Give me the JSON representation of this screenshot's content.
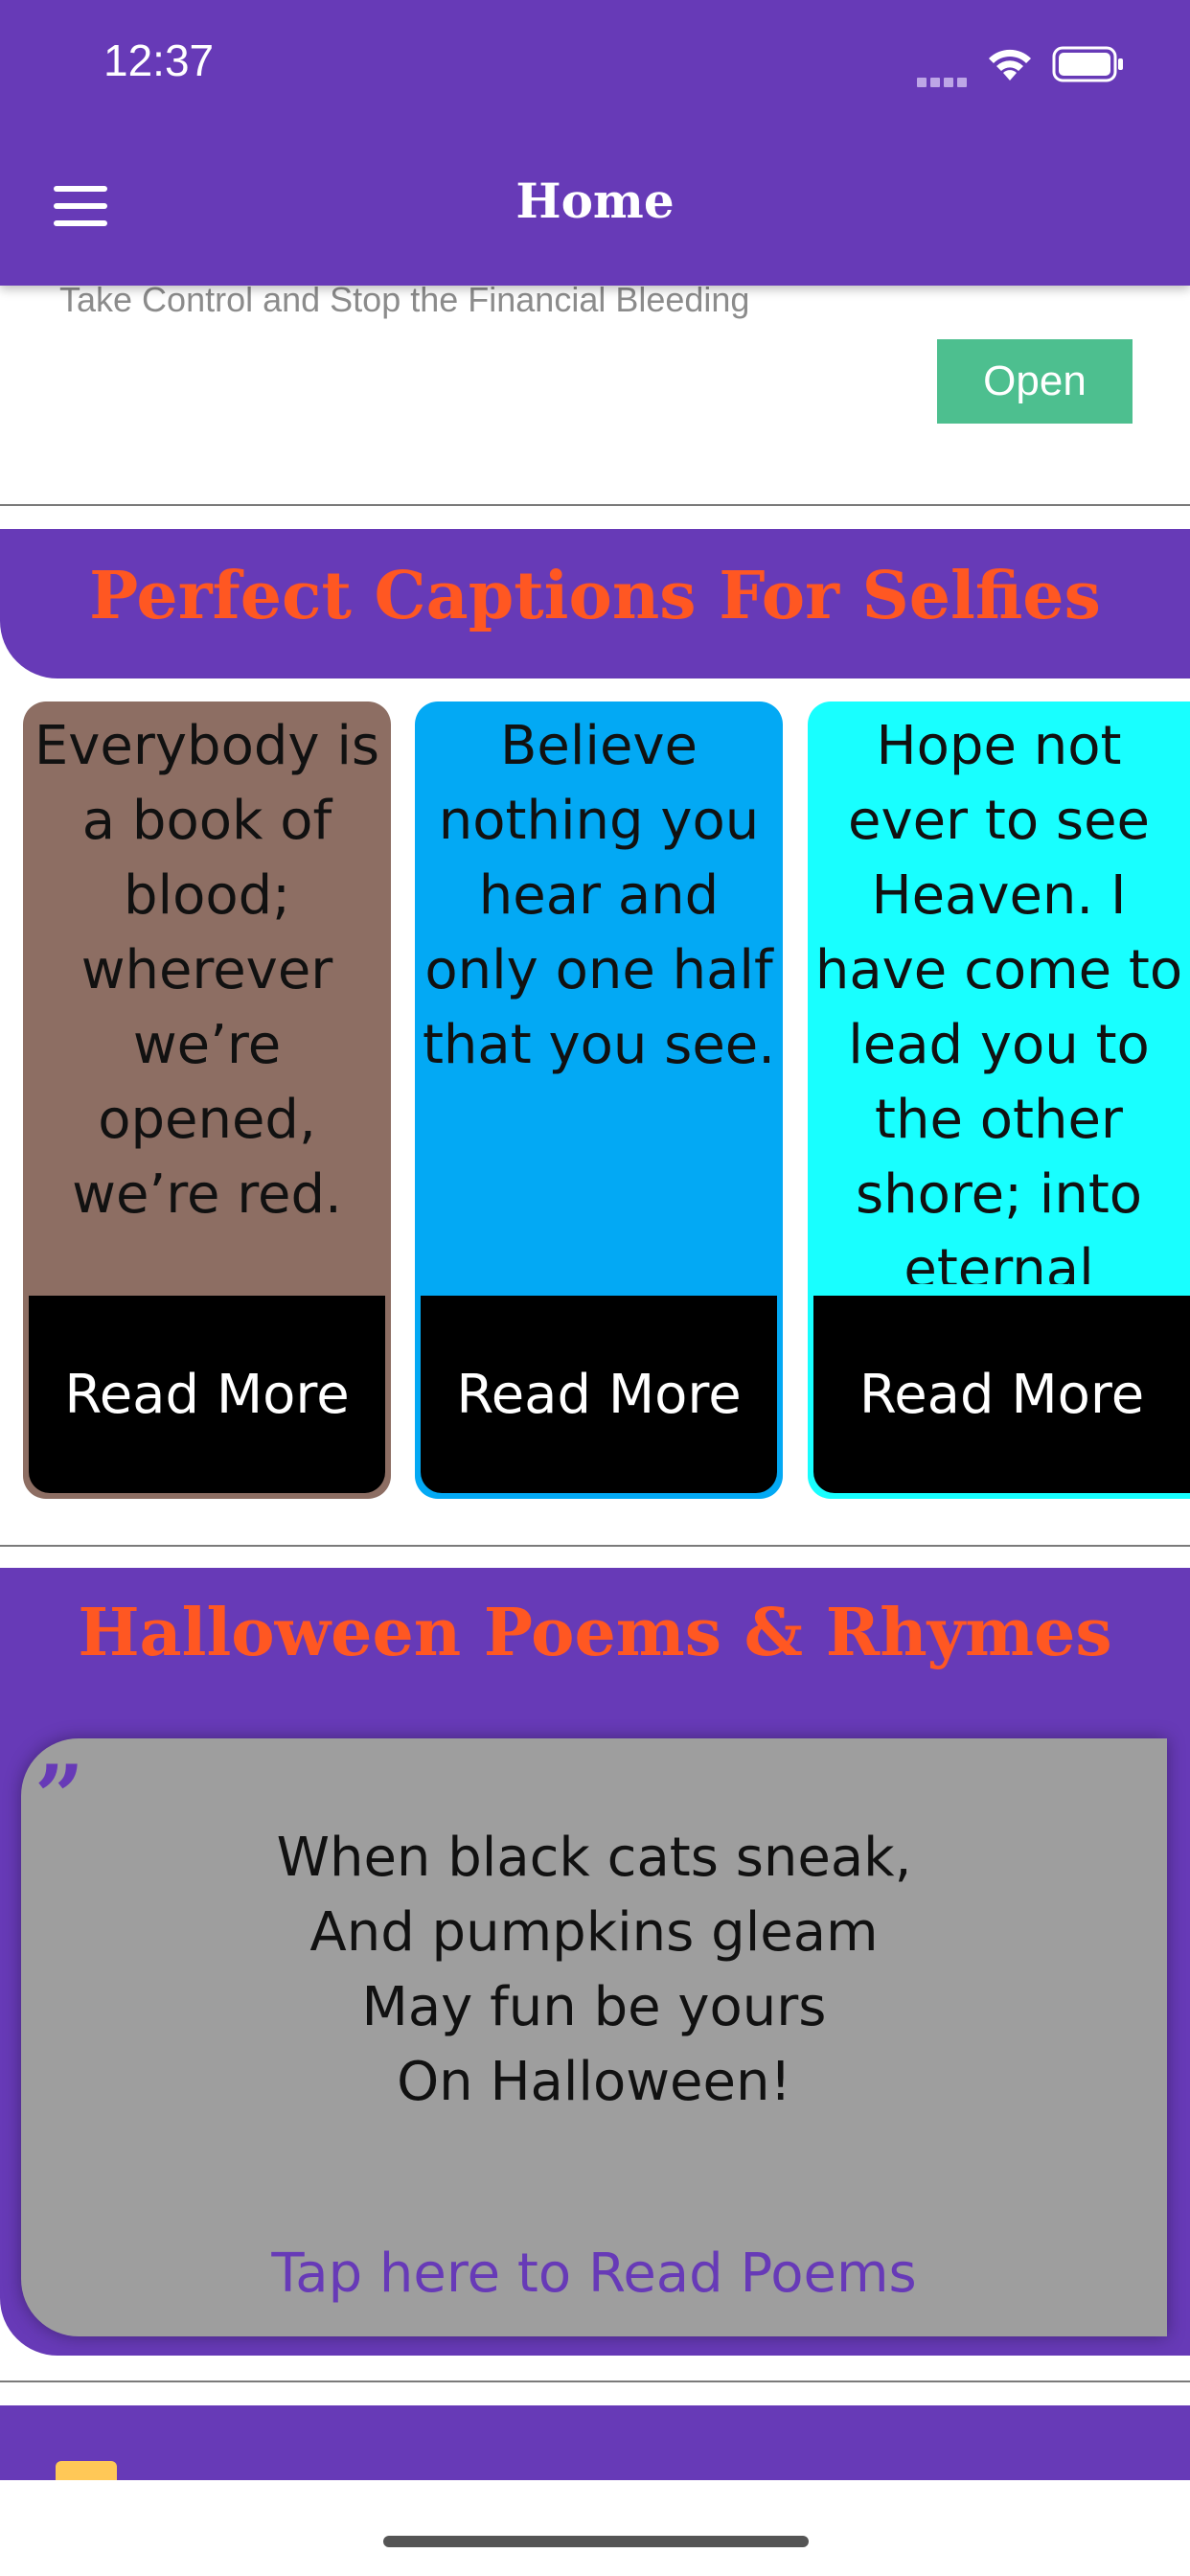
{
  "status_bar": {
    "time": "12:37"
  },
  "header": {
    "title": "Home",
    "menu_icon": "hamburger-menu-icon"
  },
  "ad": {
    "text": "Take Control and Stop the Financial Bleeding",
    "button": "Open"
  },
  "captions_section": {
    "title": "Perfect Captions For Selfies",
    "cards": [
      {
        "quote": "Everybody is a book of blood; wherever we’re opened, we’re red.",
        "button": "Read More",
        "color": "#8d6e63"
      },
      {
        "quote": "Believe nothing you hear and only one half that you see.",
        "button": "Read More",
        "color": "#03a9f4"
      },
      {
        "quote": "Hope not ever to see Heaven. I have come to lead you to the other shore; into eternal",
        "button": "Read More",
        "color": "#18ffff"
      }
    ]
  },
  "poems_section": {
    "title": "Halloween Poems & Rhymes",
    "quote_icon": "quote-mark-icon",
    "lines": [
      "When black cats sneak,",
      "And pumpkins gleam",
      "May fun be yours",
      "On Halloween!"
    ],
    "link": "Tap here to Read Poems"
  },
  "colors": {
    "primary": "#673ab7",
    "accent": "#ff5722",
    "ad_button": "#4dbf8f"
  }
}
